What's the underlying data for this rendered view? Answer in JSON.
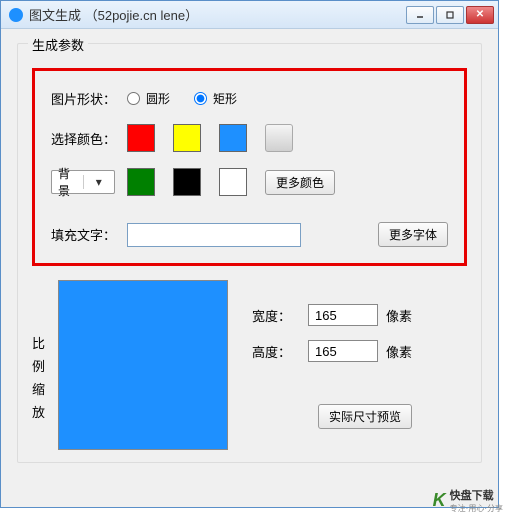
{
  "window": {
    "title": "图文生成 （52pojie.cn lene）"
  },
  "group": {
    "title": "生成参数"
  },
  "shape": {
    "label": "图片形状：",
    "circle": "圆形",
    "rect": "矩形",
    "selected": "rect"
  },
  "color": {
    "label": "选择颜色：",
    "swatches_row1": [
      "#ff0000",
      "#ffff00",
      "#1e90ff"
    ],
    "swatches_row2": [
      "#008000",
      "#000000",
      "#ffffff"
    ],
    "bg_combo": "背景",
    "more_colors": "更多颜色"
  },
  "text": {
    "label": "填充文字：",
    "value": "",
    "more_fonts": "更多字体"
  },
  "scale": {
    "vlabel": [
      "比",
      "例",
      "缩",
      "放"
    ]
  },
  "size": {
    "width_label": "宽度：",
    "width_value": "165",
    "height_label": "高度：",
    "height_value": "165",
    "unit": "像素",
    "preview_btn": "实际尺寸预览"
  },
  "preview_color": "#1e90ff",
  "logo": {
    "brand": "快盘下载",
    "sub": "专注·用心·分享"
  }
}
